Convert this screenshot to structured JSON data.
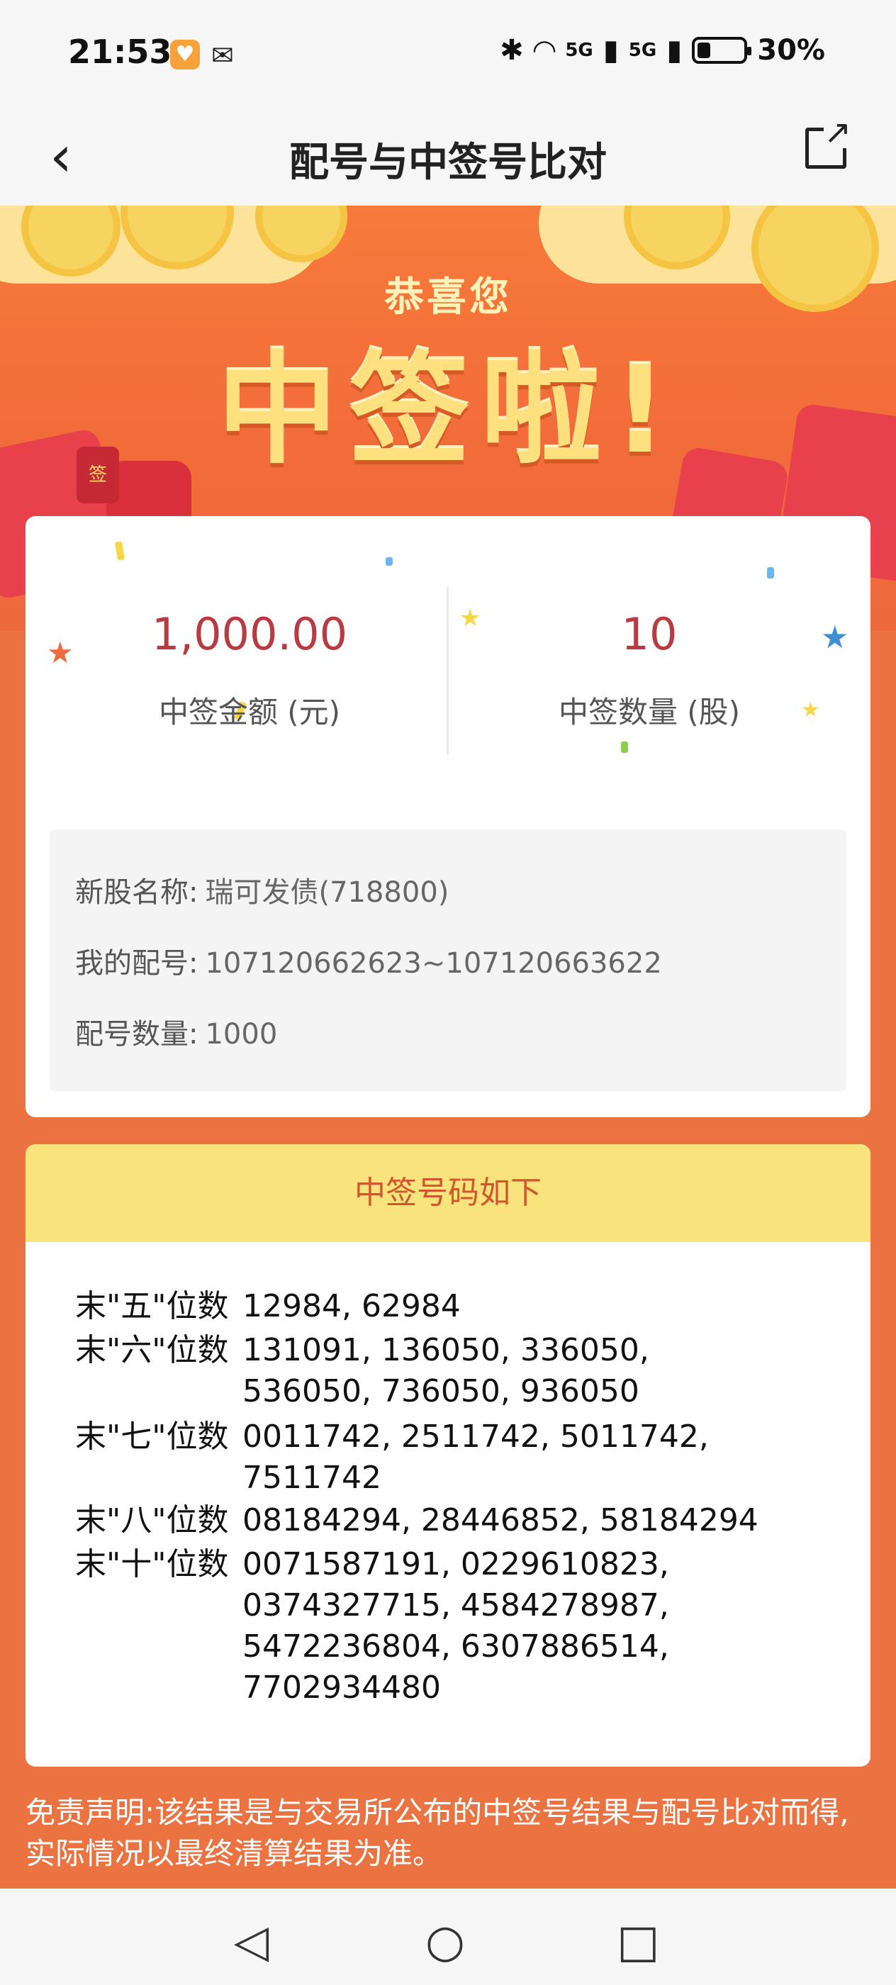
{
  "status_bar": {
    "time": "21:53",
    "battery": "30%",
    "signal_labels": [
      "5G",
      "5G"
    ]
  },
  "header": {
    "title": "配号与中签号比对",
    "back_icon": "chevron-left-icon",
    "share_icon": "share-external-icon"
  },
  "banner": {
    "congrats": "恭喜您",
    "headline": "中签啦!",
    "packet_char": "签"
  },
  "summary": {
    "amount_value": "1,000.00",
    "amount_label": "中签金额 (元)",
    "qty_value": "10",
    "qty_label": "中签数量 (股)"
  },
  "info": {
    "name_key": "新股名称:",
    "name_val": "瑞可发债(718800)",
    "range_key": "我的配号:",
    "range_val": "107120662623~107120663622",
    "count_key": "配号数量:",
    "count_val": "1000"
  },
  "lottery": {
    "title": "中签号码如下",
    "rows": [
      {
        "key": "末\"五\"位数",
        "val": "12984, 62984"
      },
      {
        "key": "末\"六\"位数",
        "val": "131091, 136050, 336050,\n536050, 736050, 936050"
      },
      {
        "key": "末\"七\"位数",
        "val": "0011742, 2511742, 5011742,\n7511742"
      },
      {
        "key": "末\"八\"位数",
        "val": "08184294, 28446852, 58184294"
      },
      {
        "key": "末\"十\"位数",
        "val": "0071587191, 0229610823,\n0374327715, 4584278987,\n5472236804, 6307886514,\n7702934480"
      }
    ]
  },
  "disclaimer": "免责声明:该结果是与交易所公布的中签号结果与配号比对而得,实际情况以最终清算结果为准。",
  "nav": {
    "back": "◁",
    "home": "○",
    "recent": "□"
  },
  "colors": {
    "accent_red": "#b83a43",
    "page_orange": "#ea7341",
    "header_yellow": "#f9e37c"
  }
}
